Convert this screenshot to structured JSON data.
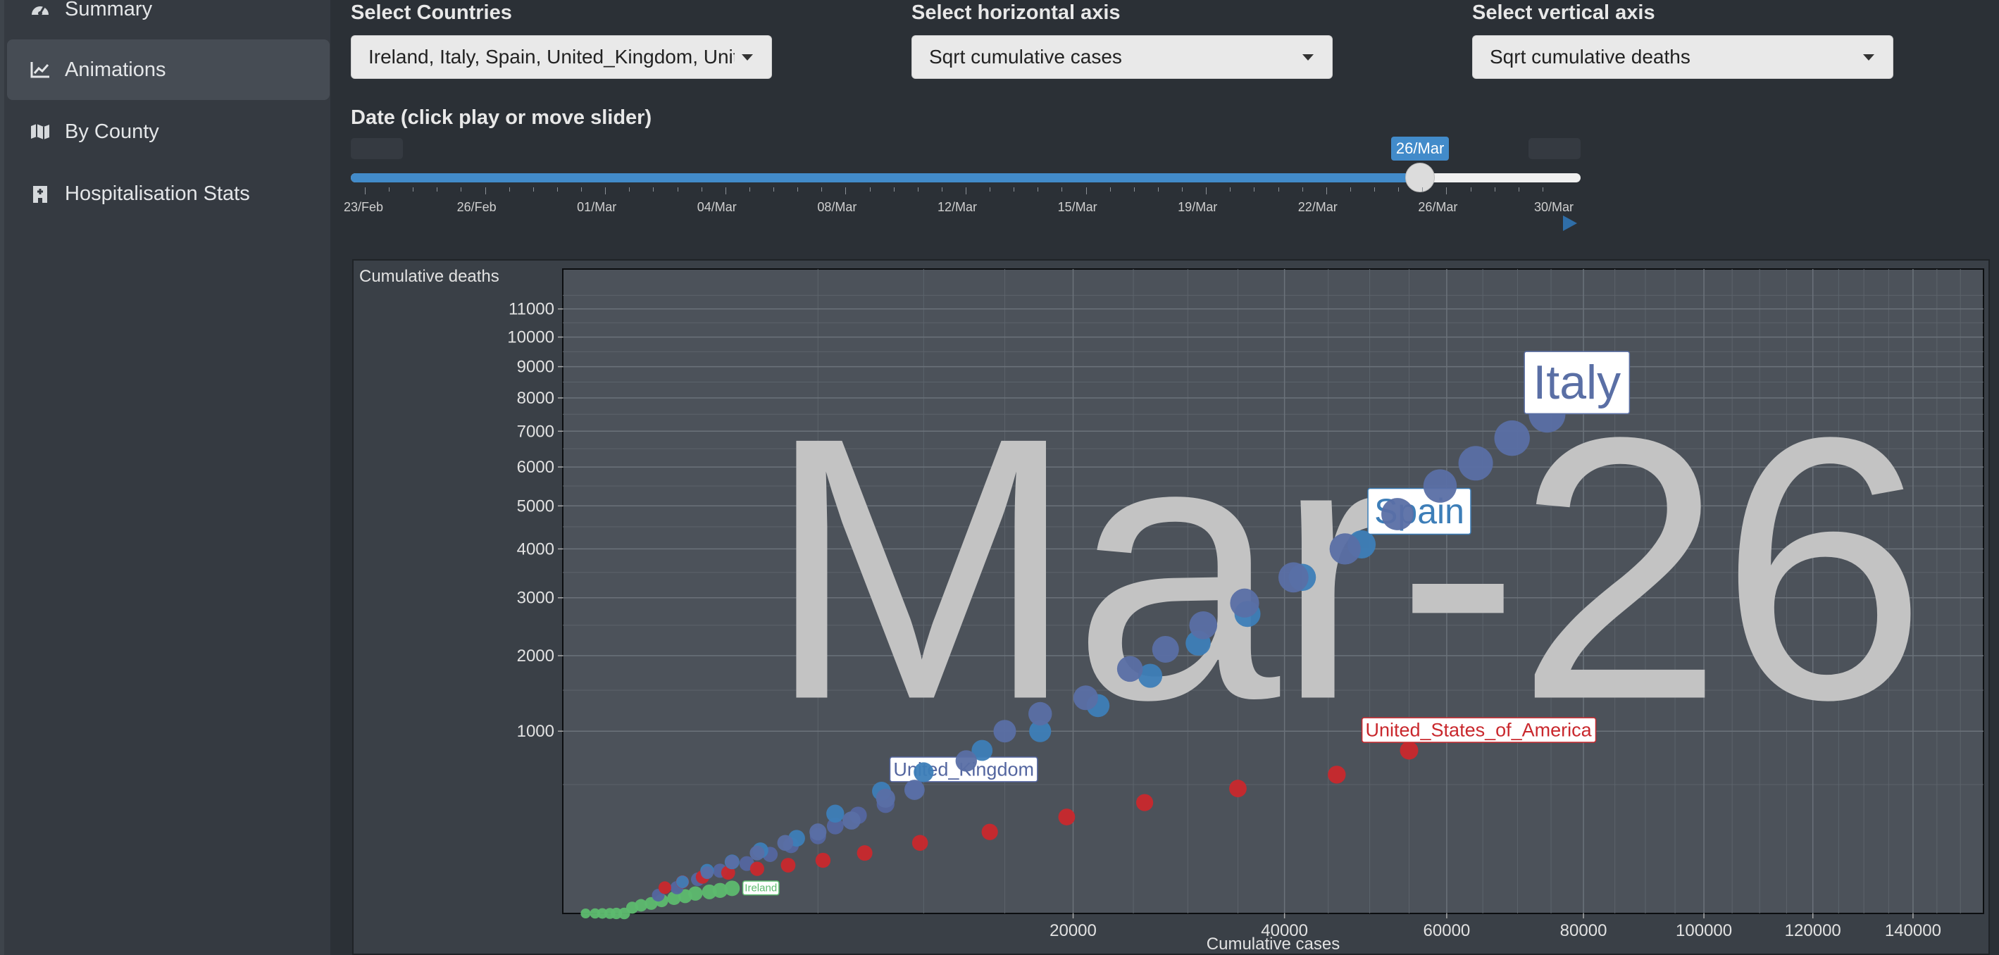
{
  "sidebar": {
    "items": [
      {
        "label": "Summary",
        "icon": "dashboard-icon",
        "active": false
      },
      {
        "label": "Animations",
        "icon": "line-chart-icon",
        "active": true
      },
      {
        "label": "By County",
        "icon": "map-icon",
        "active": false
      },
      {
        "label": "Hospitalisation Stats",
        "icon": "hospital-icon",
        "active": false
      }
    ]
  },
  "controls": {
    "countries_label": "Select Countries",
    "countries_value": "Ireland, Italy, Spain, United_Kingdom, United_States_of_America",
    "haxis_label": "Select horizontal axis",
    "haxis_value": "Sqrt cumulative cases",
    "vaxis_label": "Select vertical axis",
    "vaxis_value": "Sqrt cumulative deaths",
    "date_label": "Date (click play or move slider)"
  },
  "slider": {
    "current": "26/Mar",
    "current_fraction": 0.878,
    "ticks": [
      "23/Feb",
      "26/Feb",
      "01/Mar",
      "04/Mar",
      "08/Mar",
      "12/Mar",
      "15/Mar",
      "19/Mar",
      "22/Mar",
      "26/Mar",
      "30/Mar"
    ]
  },
  "colors": {
    "accent": "#428bca",
    "Ireland": "#5dbb6f",
    "Italy": "#5a6fa5",
    "Spain": "#3d7eb8",
    "United_Kingdom": "#5466a0",
    "United_States_of_America": "#c9282d"
  },
  "chart_data": {
    "type": "scatter",
    "scale": "sqrt",
    "watermark": "Mar-26",
    "xlabel": "Cumulative cases",
    "ylabel": "Cumulative deaths",
    "xlim": [
      0,
      155000
    ],
    "ylim": [
      0,
      12500
    ],
    "x_ticks": [
      20000,
      40000,
      60000,
      80000,
      100000,
      120000,
      140000
    ],
    "y_ticks": [
      1000,
      2000,
      3000,
      4000,
      5000,
      6000,
      7000,
      8000,
      9000,
      10000,
      11000
    ],
    "series": [
      {
        "name": "Ireland",
        "label_size": "small",
        "x": [
          40,
          80,
          120,
          170,
          220,
          290,
          370,
          470,
          600,
          750,
          950,
          1150,
          1350,
          1650,
          1900,
          2200
        ],
        "y": [
          0,
          0,
          0,
          0,
          0,
          0,
          1,
          2,
          3,
          5,
          7,
          9,
          12,
          14,
          16,
          19
        ]
      },
      {
        "name": "United_Kingdom",
        "label_size": "medium",
        "x": [
          700,
          1000,
          1400,
          1900,
          2600,
          3300,
          4000,
          5000,
          5700,
          6700,
          8000,
          9500
        ],
        "y": [
          10,
          20,
          35,
          55,
          75,
          105,
          140,
          180,
          230,
          290,
          360,
          460
        ]
      },
      {
        "name": "United_States_of_America",
        "label_size": "medium",
        "x": [
          800,
          1100,
          1500,
          2100,
          2900,
          3900,
          5200,
          7000,
          9800,
          14000,
          19500,
          26000,
          35000,
          46000,
          55000
        ],
        "y": [
          20,
          30,
          40,
          50,
          60,
          70,
          85,
          110,
          150,
          200,
          280,
          370,
          470,
          580,
          800
        ]
      },
      {
        "name": "Spain",
        "label_size": "large",
        "x": [
          1100,
          1600,
          2200,
          3000,
          4200,
          5700,
          7800,
          10000,
          13500,
          17500,
          22000,
          26500,
          31000,
          36000,
          42000,
          49000
        ],
        "y": [
          30,
          55,
          80,
          120,
          170,
          300,
          450,
          600,
          800,
          1000,
          1300,
          1700,
          2200,
          2700,
          3400,
          4100
        ]
      },
      {
        "name": "Italy",
        "label_size": "xlarge",
        "x": [
          1600,
          2200,
          2900,
          3800,
          5000,
          6400,
          8000,
          9500,
          12500,
          15000,
          17500,
          21000,
          24700,
          27900,
          31500,
          35700,
          41000,
          47000,
          53500,
          59100,
          64000,
          69200,
          74400
        ],
        "y": [
          50,
          80,
          110,
          150,
          200,
          260,
          400,
          460,
          700,
          1000,
          1200,
          1400,
          1800,
          2100,
          2500,
          2900,
          3400,
          4000,
          4800,
          5500,
          6100,
          6800,
          7500
        ]
      }
    ]
  }
}
